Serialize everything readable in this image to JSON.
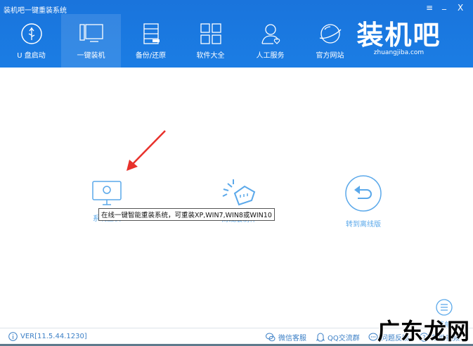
{
  "window": {
    "title": "装机吧一键重装系统",
    "menu_icon": "≡",
    "minimize_icon": "_",
    "close_icon": "X"
  },
  "nav": [
    {
      "label": "U 盘启动"
    },
    {
      "label": "一键装机"
    },
    {
      "label": "备份/还原"
    },
    {
      "label": "软件大全"
    },
    {
      "label": "人工服务"
    },
    {
      "label": "官方网站"
    }
  ],
  "logo": {
    "text": "装机吧",
    "url_text": "zhuangjiba.com"
  },
  "features": [
    {
      "label": "系统重装"
    },
    {
      "label": "离线版制作"
    },
    {
      "label": "转到离线版"
    }
  ],
  "tooltip": "在线一键智能重装系统，可重装XP,WIN7,WIN8或WIN10",
  "menu_label": "菜单",
  "footer": {
    "version": "VER[11.5.44.1230]",
    "wechat": "微信客服",
    "qq": "QQ交流群",
    "feedback": "问题反馈",
    "help": "帮助视频"
  },
  "watermark": "广东龙网",
  "colors": {
    "header": "#1a74dc",
    "accent": "#5aa8ea",
    "arrow": "#e8312b"
  }
}
